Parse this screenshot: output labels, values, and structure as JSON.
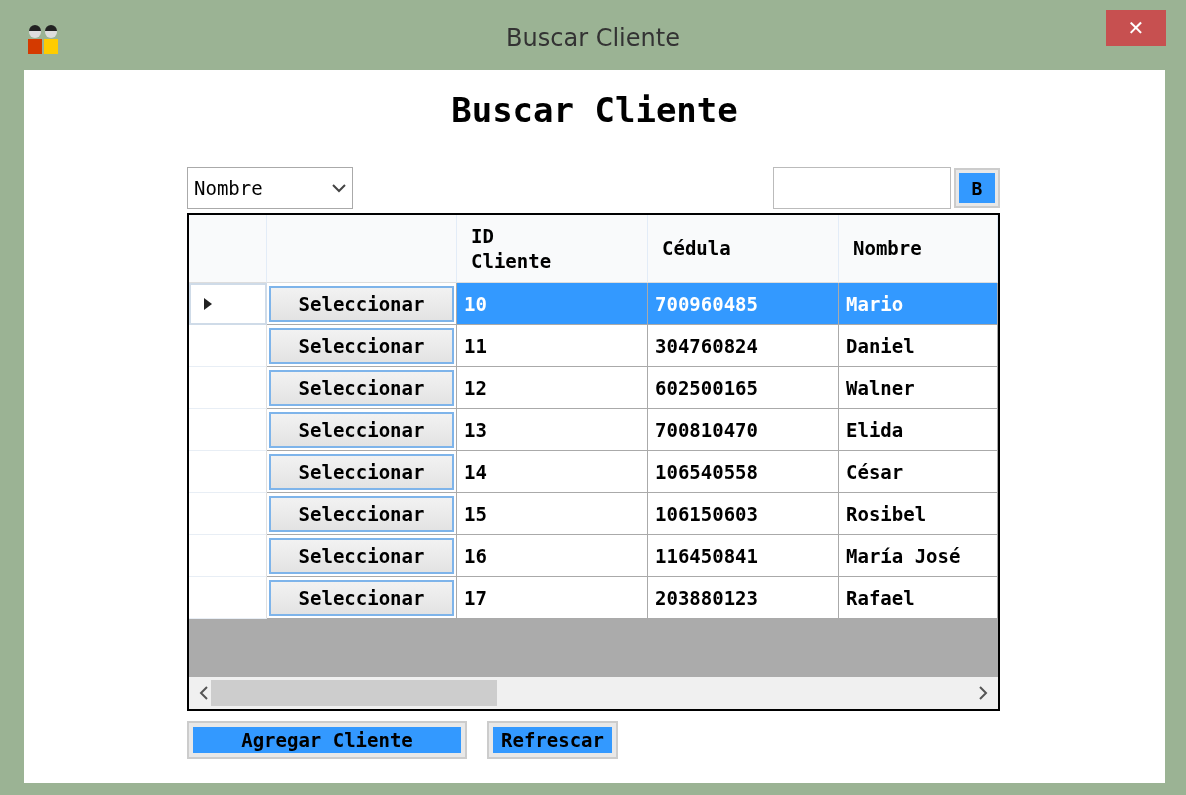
{
  "window": {
    "title": "Buscar Cliente",
    "close": "✕"
  },
  "heading": "Buscar Cliente",
  "filter": {
    "value": "Nombre"
  },
  "search": {
    "button": "B"
  },
  "table": {
    "columns": [
      "ID Cliente",
      "Cédula",
      "Nombre"
    ],
    "rows": [
      {
        "action": "Seleccionar",
        "id": "10",
        "cedula": "700960485",
        "nombre": "Mario",
        "selected": true,
        "current": true
      },
      {
        "action": "Seleccionar",
        "id": "11",
        "cedula": "304760824",
        "nombre": "Daniel",
        "selected": false,
        "current": false
      },
      {
        "action": "Seleccionar",
        "id": "12",
        "cedula": "602500165",
        "nombre": "Walner",
        "selected": false,
        "current": false
      },
      {
        "action": "Seleccionar",
        "id": "13",
        "cedula": "700810470",
        "nombre": "Elida",
        "selected": false,
        "current": false
      },
      {
        "action": "Seleccionar",
        "id": "14",
        "cedula": "106540558",
        "nombre": "César",
        "selected": false,
        "current": false
      },
      {
        "action": "Seleccionar",
        "id": "15",
        "cedula": "106150603",
        "nombre": "Rosibel",
        "selected": false,
        "current": false
      },
      {
        "action": "Seleccionar",
        "id": "16",
        "cedula": "116450841",
        "nombre": "María José",
        "selected": false,
        "current": false
      },
      {
        "action": "Seleccionar",
        "id": "17",
        "cedula": "203880123",
        "nombre": "Rafael",
        "selected": false,
        "current": false
      }
    ]
  },
  "buttons": [
    "Agregar Cliente",
    "Refrescar"
  ]
}
